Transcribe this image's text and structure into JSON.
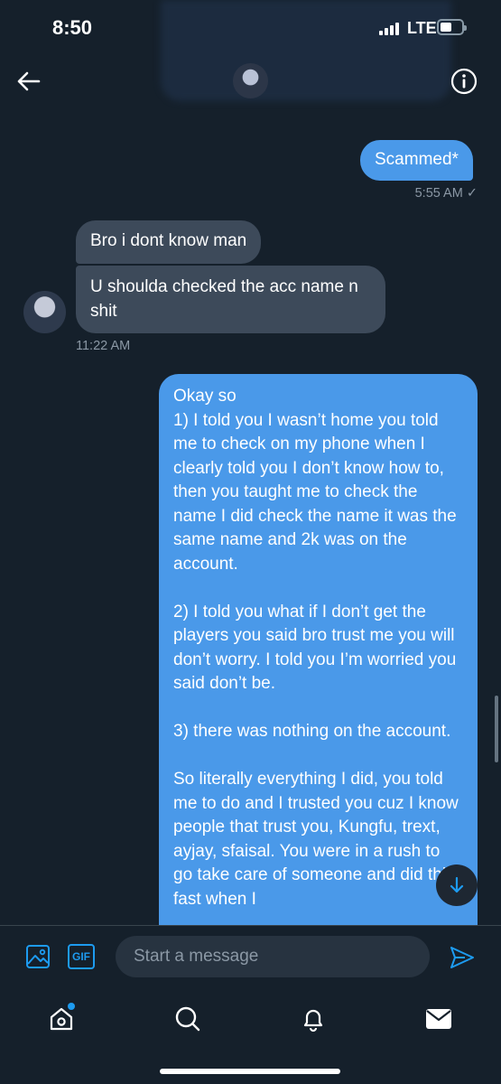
{
  "status": {
    "time": "8:50",
    "network": "LTE"
  },
  "header": {
    "back_icon": "arrow-left-icon",
    "info_icon": "info-icon"
  },
  "messages": [
    {
      "direction": "out",
      "text": "Scammed*"
    },
    {
      "direction": "out_timestamp",
      "text": "5:55 AM ✓"
    },
    {
      "direction": "in",
      "text": "Bro i dont know man"
    },
    {
      "direction": "in",
      "text": "U shoulda checked the acc name n shit"
    },
    {
      "direction": "in_timestamp",
      "text": "11:22 AM"
    },
    {
      "direction": "out",
      "text": "Okay so\n1) I told you I wasn’t home you told me to check on my phone when I clearly told you I don’t know how to, then you taught me to check the name I did check the name it was the same name and 2k was on the account.\n\n2) I told you what if I don’t get the players you said bro trust me you will don’t worry. I told you I’m worried you said don’t be.\n\n3) there was nothing on the account.\n\nSo literally everything I did, you told me to do and I trusted you cuz I know people that trust you, Kungfu, trext, ayjay, sfaisal. You were in a rush to go take care of someone and did this fast when I"
    }
  ],
  "composer": {
    "placeholder": "Start a message",
    "gif_label": "GIF"
  },
  "colors": {
    "background": "#15202b",
    "outgoing_bubble": "#4a99e9",
    "incoming_bubble": "#3d4a5a",
    "accent": "#1d9bf0"
  }
}
